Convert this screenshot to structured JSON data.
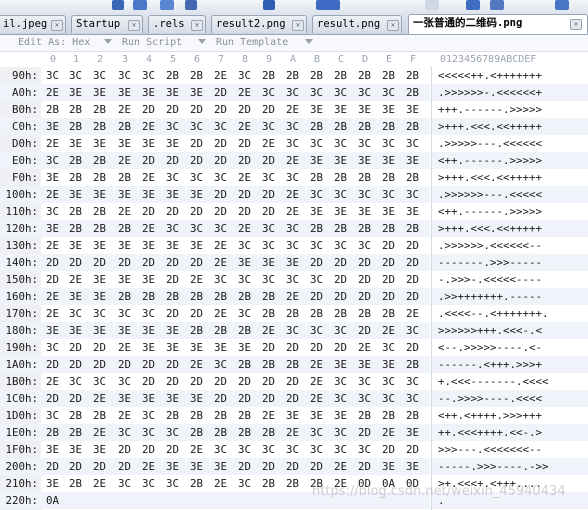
{
  "tabs": [
    {
      "label": "il.jpeg",
      "active": false
    },
    {
      "label": "Startup",
      "active": false
    },
    {
      "label": ".rels",
      "active": false
    },
    {
      "label": "result2.png",
      "active": false
    },
    {
      "label": "result.png",
      "active": false
    },
    {
      "label": "一张普通的二维码.png",
      "active": true
    }
  ],
  "template_bar": {
    "edit_as": "Edit As: Hex",
    "run_script": "Run Script",
    "run_template": "Run Template"
  },
  "column_header": {
    "hex": [
      "0",
      "1",
      "2",
      "3",
      "4",
      "5",
      "6",
      "7",
      "8",
      "9",
      "A",
      "B",
      "C",
      "D",
      "E",
      "F"
    ],
    "ascii": "0123456789ABCDEF"
  },
  "rows": [
    {
      "addr": "90h:",
      "hex": [
        "3C",
        "3C",
        "3C",
        "3C",
        "3C",
        "2B",
        "2B",
        "2E",
        "3C",
        "2B",
        "2B",
        "2B",
        "2B",
        "2B",
        "2B",
        "2B"
      ],
      "ascii": "<<<<<++.<+++++++"
    },
    {
      "addr": "A0h:",
      "hex": [
        "2E",
        "3E",
        "3E",
        "3E",
        "3E",
        "3E",
        "3E",
        "2D",
        "2E",
        "3C",
        "3C",
        "3C",
        "3C",
        "3C",
        "3C",
        "2B"
      ],
      "ascii": ".>>>>>>-.<<<<<<+"
    },
    {
      "addr": "B0h:",
      "hex": [
        "2B",
        "2B",
        "2B",
        "2E",
        "2D",
        "2D",
        "2D",
        "2D",
        "2D",
        "2D",
        "2E",
        "3E",
        "3E",
        "3E",
        "3E",
        "3E"
      ],
      "ascii": "+++.------.>>>>>"
    },
    {
      "addr": "C0h:",
      "hex": [
        "3E",
        "2B",
        "2B",
        "2B",
        "2E",
        "3C",
        "3C",
        "3C",
        "2E",
        "3C",
        "3C",
        "2B",
        "2B",
        "2B",
        "2B",
        "2B"
      ],
      "ascii": ">+++.<<<.<<+++++"
    },
    {
      "addr": "D0h:",
      "hex": [
        "2E",
        "3E",
        "3E",
        "3E",
        "3E",
        "3E",
        "2D",
        "2D",
        "2D",
        "2E",
        "3C",
        "3C",
        "3C",
        "3C",
        "3C",
        "3C"
      ],
      "ascii": ".>>>>>---.<<<<<<"
    },
    {
      "addr": "E0h:",
      "hex": [
        "3C",
        "2B",
        "2B",
        "2E",
        "2D",
        "2D",
        "2D",
        "2D",
        "2D",
        "2D",
        "2E",
        "3E",
        "3E",
        "3E",
        "3E",
        "3E"
      ],
      "ascii": "<++.------.>>>>>"
    },
    {
      "addr": "F0h:",
      "hex": [
        "3E",
        "2B",
        "2B",
        "2B",
        "2E",
        "3C",
        "3C",
        "3C",
        "2E",
        "3C",
        "3C",
        "2B",
        "2B",
        "2B",
        "2B",
        "2B"
      ],
      "ascii": ">+++.<<<.<<+++++"
    },
    {
      "addr": "100h:",
      "hex": [
        "2E",
        "3E",
        "3E",
        "3E",
        "3E",
        "3E",
        "3E",
        "2D",
        "2D",
        "2D",
        "2E",
        "3C",
        "3C",
        "3C",
        "3C",
        "3C"
      ],
      "ascii": ".>>>>>>---.<<<<<"
    },
    {
      "addr": "110h:",
      "hex": [
        "3C",
        "2B",
        "2B",
        "2E",
        "2D",
        "2D",
        "2D",
        "2D",
        "2D",
        "2D",
        "2E",
        "3E",
        "3E",
        "3E",
        "3E",
        "3E"
      ],
      "ascii": "<++.------.>>>>>"
    },
    {
      "addr": "120h:",
      "hex": [
        "3E",
        "2B",
        "2B",
        "2B",
        "2E",
        "3C",
        "3C",
        "3C",
        "2E",
        "3C",
        "3C",
        "2B",
        "2B",
        "2B",
        "2B",
        "2B"
      ],
      "ascii": ">+++.<<<.<<+++++"
    },
    {
      "addr": "130h:",
      "hex": [
        "2E",
        "3E",
        "3E",
        "3E",
        "3E",
        "3E",
        "3E",
        "2E",
        "3C",
        "3C",
        "3C",
        "3C",
        "3C",
        "3C",
        "2D",
        "2D"
      ],
      "ascii": ".>>>>>>.<<<<<<--"
    },
    {
      "addr": "140h:",
      "hex": [
        "2D",
        "2D",
        "2D",
        "2D",
        "2D",
        "2D",
        "2D",
        "2E",
        "3E",
        "3E",
        "3E",
        "2D",
        "2D",
        "2D",
        "2D",
        "2D"
      ],
      "ascii": "-------.>>>-----"
    },
    {
      "addr": "150h:",
      "hex": [
        "2D",
        "2E",
        "3E",
        "3E",
        "3E",
        "2D",
        "2E",
        "3C",
        "3C",
        "3C",
        "3C",
        "3C",
        "2D",
        "2D",
        "2D",
        "2D"
      ],
      "ascii": "-.>>>-.<<<<<----"
    },
    {
      "addr": "160h:",
      "hex": [
        "2E",
        "3E",
        "3E",
        "2B",
        "2B",
        "2B",
        "2B",
        "2B",
        "2B",
        "2B",
        "2E",
        "2D",
        "2D",
        "2D",
        "2D",
        "2D"
      ],
      "ascii": ".>>+++++++.-----"
    },
    {
      "addr": "170h:",
      "hex": [
        "2E",
        "3C",
        "3C",
        "3C",
        "3C",
        "2D",
        "2D",
        "2E",
        "3C",
        "2B",
        "2B",
        "2B",
        "2B",
        "2B",
        "2B",
        "2E"
      ],
      "ascii": ".<<<<--.<+++++++."
    },
    {
      "addr": "180h:",
      "hex": [
        "3E",
        "3E",
        "3E",
        "3E",
        "3E",
        "3E",
        "2B",
        "2B",
        "2B",
        "2E",
        "3C",
        "3C",
        "3C",
        "2D",
        "2E",
        "3C"
      ],
      "ascii": ">>>>>>+++.<<<-.<"
    },
    {
      "addr": "190h:",
      "hex": [
        "3C",
        "2D",
        "2D",
        "2E",
        "3E",
        "3E",
        "3E",
        "3E",
        "3E",
        "2D",
        "2D",
        "2D",
        "2D",
        "2E",
        "3C",
        "2D"
      ],
      "ascii": "<--.>>>>>----.<-"
    },
    {
      "addr": "1A0h:",
      "hex": [
        "2D",
        "2D",
        "2D",
        "2D",
        "2D",
        "2D",
        "2E",
        "3C",
        "2B",
        "2B",
        "2B",
        "2E",
        "3E",
        "3E",
        "3E",
        "2B"
      ],
      "ascii": "------.<+++.>>>+"
    },
    {
      "addr": "1B0h:",
      "hex": [
        "2E",
        "3C",
        "3C",
        "3C",
        "2D",
        "2D",
        "2D",
        "2D",
        "2D",
        "2D",
        "2D",
        "2E",
        "3C",
        "3C",
        "3C",
        "3C"
      ],
      "ascii": "+.<<<-------.<<<<"
    },
    {
      "addr": "1C0h:",
      "hex": [
        "2D",
        "2D",
        "2E",
        "3E",
        "3E",
        "3E",
        "3E",
        "2D",
        "2D",
        "2D",
        "2D",
        "2E",
        "3C",
        "3C",
        "3C",
        "3C"
      ],
      "ascii": "--.>>>>----.<<<<"
    },
    {
      "addr": "1D0h:",
      "hex": [
        "3C",
        "2B",
        "2B",
        "2E",
        "3C",
        "2B",
        "2B",
        "2B",
        "2B",
        "2E",
        "3E",
        "3E",
        "3E",
        "2B",
        "2B",
        "2B"
      ],
      "ascii": "<++.<++++.>>>+++"
    },
    {
      "addr": "1E0h:",
      "hex": [
        "2B",
        "2B",
        "2E",
        "3C",
        "3C",
        "3C",
        "2B",
        "2B",
        "2B",
        "2B",
        "2E",
        "3C",
        "3C",
        "2D",
        "2E",
        "3E"
      ],
      "ascii": "++.<<<++++.<<-.>"
    },
    {
      "addr": "1F0h:",
      "hex": [
        "3E",
        "3E",
        "3E",
        "2D",
        "2D",
        "2D",
        "2E",
        "3C",
        "3C",
        "3C",
        "3C",
        "3C",
        "3C",
        "3C",
        "2D",
        "2D"
      ],
      "ascii": ">>>---.<<<<<<<--"
    },
    {
      "addr": "200h:",
      "hex": [
        "2D",
        "2D",
        "2D",
        "2D",
        "2E",
        "3E",
        "3E",
        "3E",
        "2D",
        "2D",
        "2D",
        "2D",
        "2E",
        "2D",
        "3E",
        "3E"
      ],
      "ascii": "-----.>>>----.->>"
    },
    {
      "addr": "210h:",
      "hex": [
        "3E",
        "2B",
        "2E",
        "3C",
        "3C",
        "3C",
        "2B",
        "2E",
        "3C",
        "2B",
        "2B",
        "2B",
        "2E",
        "0D",
        "0A",
        "0D"
      ],
      "ascii": ">+.<<<+.<+++...."
    },
    {
      "addr": "220h:",
      "hex": [
        "0A"
      ],
      "ascii": "."
    }
  ],
  "watermark": "https://blog.csdn.net/weixin_45940434"
}
